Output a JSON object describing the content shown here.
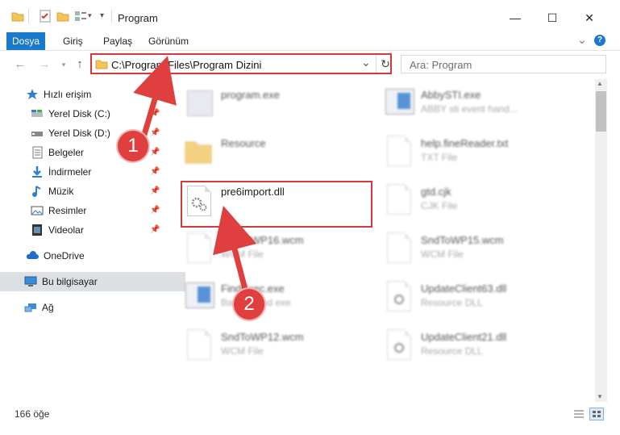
{
  "window": {
    "title": "Program",
    "minimize_glyph": "—",
    "maximize_glyph": "☐",
    "close_glyph": "✕"
  },
  "ribbon": {
    "file_tab": "Dosya",
    "tabs": [
      "Giriş",
      "Paylaş",
      "Görünüm"
    ],
    "collapse_glyph": "⌄",
    "help_glyph": "?"
  },
  "address": {
    "path": "C:\\Program Files\\Program Dizini",
    "dropdown_glyph": "⌄",
    "refresh_glyph": "↻"
  },
  "search": {
    "placeholder": "Ara: Program"
  },
  "sidebar": {
    "quick_access": "Hızlı erişim",
    "items": [
      {
        "label": "Yerel Disk (C:)"
      },
      {
        "label": "Yerel Disk (D:)"
      },
      {
        "label": "Belgeler"
      },
      {
        "label": "İndirmeler"
      },
      {
        "label": "Müzik"
      },
      {
        "label": "Resimler"
      },
      {
        "label": "Videolar"
      }
    ],
    "onedrive": "OneDrive",
    "this_pc": "Bu bilgisayar",
    "network": "Ağ"
  },
  "files_left": [
    {
      "name": "program.exe",
      "type": ""
    },
    {
      "name": "Resource",
      "type": ""
    },
    {
      "name": "pre6import.dll",
      "type": ""
    },
    {
      "name": "SndToWP16.wcm",
      "type": "WCM File"
    },
    {
      "name": "FindExec.exe",
      "type": "Background exe"
    },
    {
      "name": "SndToWP12.wcm",
      "type": "WCM File"
    }
  ],
  "files_right": [
    {
      "name": "AbbySTI.exe",
      "type": "ABBY sti event hand..."
    },
    {
      "name": "help.fineReader.txt",
      "type": "TXT File"
    },
    {
      "name": "gtd.cjk",
      "type": "CJK File"
    },
    {
      "name": "SndToWP15.wcm",
      "type": "WCM File"
    },
    {
      "name": "UpdateClient63.dll",
      "type": "Resource DLL"
    },
    {
      "name": "UpdateClient21.dll",
      "type": "Resource DLL"
    }
  ],
  "annotations": {
    "badge1": "1",
    "badge2": "2",
    "color": "#e03f3f"
  },
  "status": {
    "count": "166 öğe"
  }
}
